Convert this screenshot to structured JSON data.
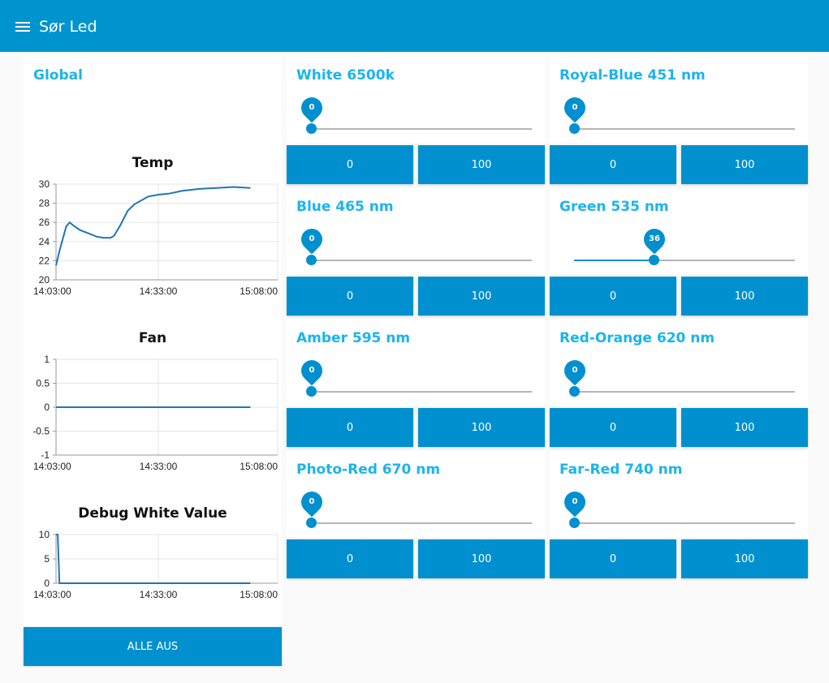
{
  "header": {
    "title": "Sør Led",
    "menu_icon": "menu-icon"
  },
  "global": {
    "title": "Global",
    "all_off_label": "ALLE AUS"
  },
  "charts": [
    {
      "title": "Temp",
      "y_ticks": [
        "30",
        "28",
        "26",
        "24",
        "22",
        "20"
      ],
      "x_ticks": [
        "14:03:00",
        "14:33:00",
        "15:08:00"
      ]
    },
    {
      "title": "Fan",
      "y_ticks": [
        "1",
        "0.5",
        "0",
        "-0.5",
        "-1"
      ],
      "x_ticks": [
        "14:03:00",
        "14:33:00",
        "15:08:00"
      ]
    },
    {
      "title": "Debug White Value",
      "y_ticks": [
        "10",
        "5",
        "0"
      ],
      "x_ticks": [
        "14:03:00",
        "14:33:00",
        "15:08:00"
      ]
    }
  ],
  "chart_data": [
    {
      "type": "line",
      "title": "Temp",
      "ylim": [
        20,
        30
      ],
      "x_ticks": [
        "14:03:00",
        "14:33:00",
        "15:08:00"
      ],
      "x": [
        "14:03:00",
        "14:04:00",
        "14:06:00",
        "14:07:00",
        "14:08:00",
        "14:10:00",
        "14:13:00",
        "14:15:00",
        "14:17:00",
        "14:19:00",
        "14:20:00",
        "14:22:00",
        "14:24:00",
        "14:26:00",
        "14:28:00",
        "14:30:00",
        "14:33:00",
        "14:36:00",
        "14:40:00",
        "14:45:00",
        "14:50:00",
        "14:55:00",
        "15:00:00"
      ],
      "series": [
        {
          "color": "#1f77b4",
          "values": [
            21.5,
            23.0,
            25.6,
            26.0,
            25.7,
            25.2,
            24.8,
            24.5,
            24.4,
            24.4,
            24.6,
            25.8,
            27.2,
            27.9,
            28.3,
            28.7,
            28.9,
            29.0,
            29.3,
            29.5,
            29.6,
            29.7,
            29.6
          ]
        }
      ]
    },
    {
      "type": "line",
      "title": "Fan",
      "ylim": [
        -1,
        1
      ],
      "x_ticks": [
        "14:03:00",
        "14:33:00",
        "15:08:00"
      ],
      "x": [
        "14:03:00",
        "15:00:00"
      ],
      "series": [
        {
          "color": "#1f77b4",
          "values": [
            0,
            0
          ]
        }
      ]
    },
    {
      "type": "line",
      "title": "Debug White Value",
      "ylim": [
        0,
        10
      ],
      "x_ticks": [
        "14:03:00",
        "14:33:00",
        "15:08:00"
      ],
      "x": [
        "14:03:00",
        "14:03:30",
        "14:04:00",
        "15:00:00"
      ],
      "series": [
        {
          "color": "#1f77b4",
          "values": [
            10,
            10,
            0,
            0
          ]
        }
      ]
    }
  ],
  "channels": [
    {
      "title": "White 6500k",
      "value": 0,
      "min": 0,
      "max": 100,
      "btn_low": "0",
      "btn_high": "100"
    },
    {
      "title": "Royal-Blue 451 nm",
      "value": 0,
      "min": 0,
      "max": 100,
      "btn_low": "0",
      "btn_high": "100"
    },
    {
      "title": "Blue 465 nm",
      "value": 0,
      "min": 0,
      "max": 100,
      "btn_low": "0",
      "btn_high": "100"
    },
    {
      "title": "Green 535 nm",
      "value": 36,
      "min": 0,
      "max": 100,
      "btn_low": "0",
      "btn_high": "100"
    },
    {
      "title": "Amber 595 nm",
      "value": 0,
      "min": 0,
      "max": 100,
      "btn_low": "0",
      "btn_high": "100"
    },
    {
      "title": "Red-Orange 620 nm",
      "value": 0,
      "min": 0,
      "max": 100,
      "btn_low": "0",
      "btn_high": "100"
    },
    {
      "title": "Photo-Red 670 nm",
      "value": 0,
      "min": 0,
      "max": 100,
      "btn_low": "0",
      "btn_high": "100"
    },
    {
      "title": "Far-Red 740 nm",
      "value": 0,
      "min": 0,
      "max": 100,
      "btn_low": "0",
      "btn_high": "100"
    }
  ],
  "colors": {
    "toolbar": "#0094ce",
    "accent": "#0090cf",
    "title": "#1bb4ec",
    "line": "#1f77b4"
  }
}
